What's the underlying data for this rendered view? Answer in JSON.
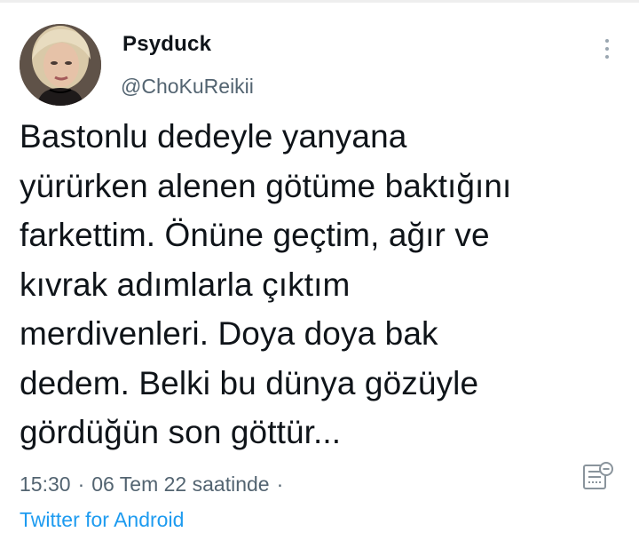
{
  "tweet": {
    "author": {
      "display_name": "Psyduck",
      "handle": "@ChoKuReikii"
    },
    "text_lines": [
      "Bastonlu dedeyle yanyana",
      "yürürken alenen götüme baktığını",
      "farkettim. Önüne geçtim, ağır ve",
      "kıvrak adımlarla çıktım",
      "merdivenleri. Doya doya bak",
      "dedem. Belki bu dünya gözüyle",
      "gördüğün son göttür..."
    ],
    "time": "15:30",
    "date": "06 Tem 22 saatinde",
    "separator": "·",
    "trailing_dot": "·",
    "source": "Twitter for Android"
  },
  "icons": {
    "more": "more-vertical-icon",
    "analytics": "analytics-icon"
  },
  "colors": {
    "text": "#0f1419",
    "secondary": "#536471",
    "link": "#1d9bf0",
    "background": "#ffffff"
  }
}
